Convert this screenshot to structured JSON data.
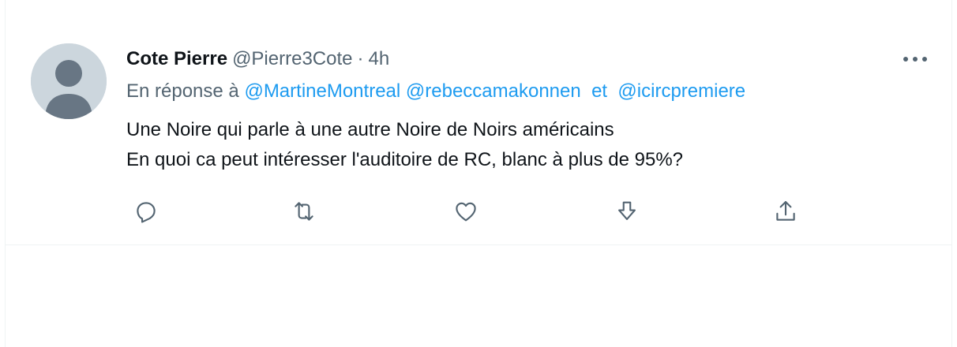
{
  "tweet": {
    "author_name": "Cote Pierre",
    "author_handle": "@Pierre3Cote",
    "separator": "·",
    "time": "4h",
    "reply_prefix": "En réponse à",
    "mentions": [
      "@MartineMontreal",
      "@rebeccamakonnen",
      "@icircpremiere"
    ],
    "conjunction": "et",
    "text_lines": [
      "Une Noire qui parle à une autre Noire de Noirs américains",
      "En quoi ca peut intéresser l'auditoire de RC, blanc à plus de 95%?"
    ],
    "actions": [
      "reply-icon",
      "retweet-icon",
      "like-icon",
      "download-icon",
      "share-icon"
    ]
  },
  "colors": {
    "text": "#0f1419",
    "secondary": "#536471",
    "accent": "#1d9bf0",
    "avatar_bg": "#ccd6dd",
    "avatar_fg": "#687684",
    "divider": "#eff3f4"
  }
}
